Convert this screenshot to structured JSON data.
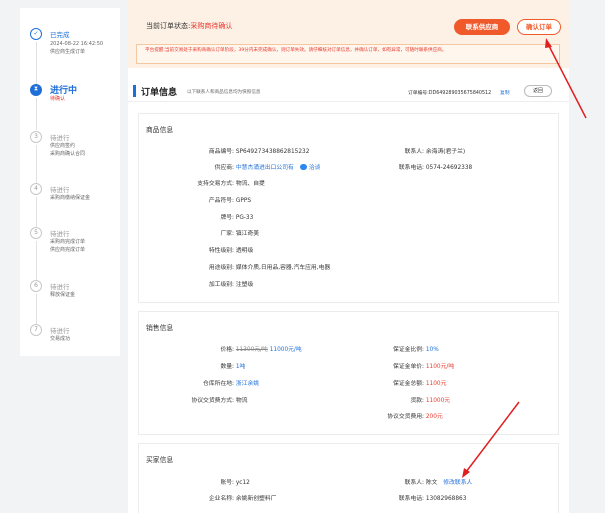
{
  "sidebar": {
    "steps": [
      {
        "num": "",
        "title": "已完成",
        "lines": [
          "2024-08-22 16:42:50",
          "供应商生成订单"
        ],
        "state": "done"
      },
      {
        "num": "",
        "title": "进行中",
        "lines": [
          "待确认"
        ],
        "state": "active"
      },
      {
        "num": "3",
        "title": "待进行",
        "lines": [
          "供应商签约",
          "采购商确认合同"
        ],
        "state": "todo"
      },
      {
        "num": "4",
        "title": "待进行",
        "lines": [
          "采购商缴纳保证金"
        ],
        "state": "todo"
      },
      {
        "num": "5",
        "title": "待进行",
        "lines": [
          "采购商完成订单",
          "供应商完成订单"
        ],
        "state": "todo"
      },
      {
        "num": "6",
        "title": "待进行",
        "lines": [
          "释放保证金"
        ],
        "state": "todo"
      },
      {
        "num": "7",
        "title": "待进行",
        "lines": [
          "交易成功"
        ],
        "state": "todo"
      }
    ]
  },
  "status": {
    "label": "当前订单状态:",
    "value": "采购商待确认",
    "contact_btn": "联系供应商",
    "confirm_btn": "确认订单",
    "notice": "平台提醒:当前交易处于采购商确认订单阶段，39分内未完成确认，则订单失效。请仔细核对订单信息，并确认订单，如有异常，可随时联系供应商。"
  },
  "order": {
    "title": "订单信息",
    "subtitle": "以下联系人和商品信息均为快照信息",
    "order_no": "订单编号:DD649289035675840512",
    "copy": "复制",
    "back": "返回"
  },
  "goods": {
    "title": "商品信息",
    "left": [
      {
        "label": "商品编号:",
        "value": "SP649273438862815232"
      },
      {
        "label": "供应商:",
        "value": "中慧杰涌进出口公司有",
        "chat": "洽谈"
      },
      {
        "label": "支持交易方式:",
        "value": "物流、自提"
      },
      {
        "label": "产品符号:",
        "value": "GPPS"
      },
      {
        "label": "牌号:",
        "value": "PG-33"
      },
      {
        "label": "厂家:",
        "value": "镇江奇美"
      },
      {
        "label": "特性级别:",
        "value": "透明级"
      },
      {
        "label": "用途级别:",
        "value": "媒体介质,日用品,容器,汽车应用,电器"
      },
      {
        "label": "加工级别:",
        "value": "注塑级"
      }
    ],
    "right": [
      {
        "label": "联系人:",
        "value": "余海涛(君子兰)"
      },
      {
        "label": "联系电话:",
        "value": "0574-24692338"
      }
    ]
  },
  "sales": {
    "title": "销售信息",
    "left": [
      {
        "label": "价格:",
        "old": "11300元/吨",
        "value": "11000元/吨"
      },
      {
        "label": "数量:",
        "value": "1吨"
      },
      {
        "label": "仓库所在地:",
        "value": "浙江余姚"
      },
      {
        "label": "协议交货费方式:",
        "value": "物流"
      }
    ],
    "right": [
      {
        "label": "保证金比例:",
        "value": "10%"
      },
      {
        "label": "保证金单价:",
        "value": "1100元/吨"
      },
      {
        "label": "保证金总额:",
        "value": "1100元"
      },
      {
        "label": "货款:",
        "value": "11000元"
      },
      {
        "label": "协议交货费用:",
        "value": "200元"
      }
    ]
  },
  "buyer": {
    "title": "买家信息",
    "account_label": "账号:",
    "account": "yc12",
    "company_label": "企业名称:",
    "company": "余姚新创塑料厂",
    "contact_label": "联系人:",
    "contact": "陈文",
    "modify": "修改联系人",
    "phone_label": "联系电话:",
    "phone": "13082968863"
  }
}
